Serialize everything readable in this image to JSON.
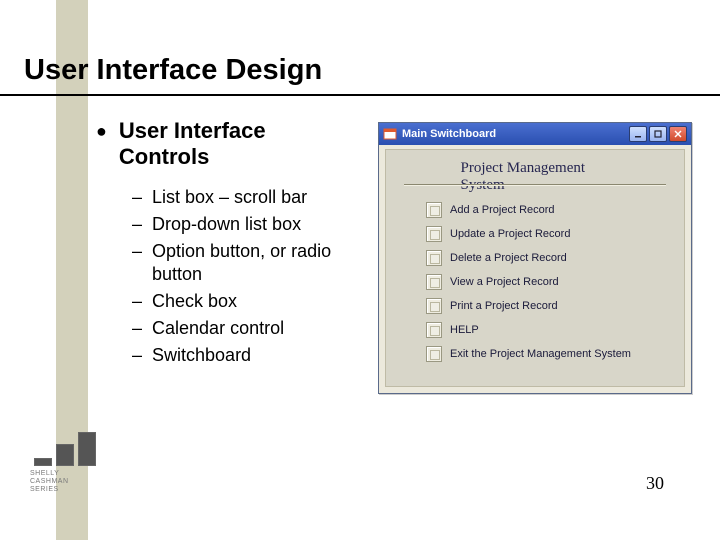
{
  "title": "User Interface Design",
  "bullet": {
    "heading_line1": "User Interface",
    "heading_line2": "Controls"
  },
  "sub_items": [
    "List box – scroll bar",
    "Drop-down list box",
    "Option button, or radio button",
    "Check box",
    "Calendar control",
    "Switchboard"
  ],
  "window": {
    "title": "Main Switchboard",
    "panel_title": "Project Management System",
    "items": [
      "Add a Project Record",
      "Update a Project Record",
      "Delete a Project Record",
      "View a Project Record",
      "Print a Project Record",
      "HELP",
      "Exit the Project Management System"
    ]
  },
  "logo": {
    "line1": "SHELLY",
    "line2": "CASHMAN",
    "line3": "SERIES"
  },
  "page_number": "30"
}
